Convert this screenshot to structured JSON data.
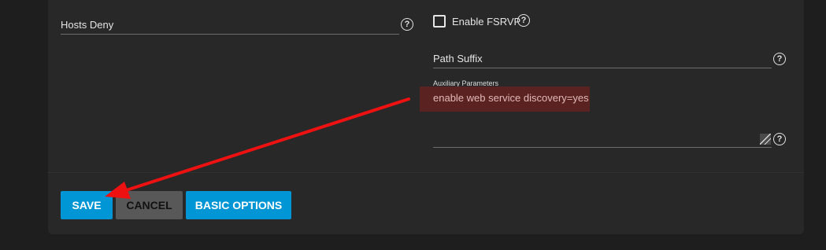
{
  "form": {
    "hosts_deny": {
      "label": "Hosts Deny",
      "help_icon": "help-circle-icon"
    },
    "enable_fsrvp": {
      "label": "Enable FSRVP",
      "checked": false,
      "help_icon": "help-circle-icon"
    },
    "path_suffix": {
      "label": "Path Suffix",
      "help_icon": "help-circle-icon"
    },
    "auxiliary_parameters": {
      "label": "Auxiliary Parameters",
      "value": "enable web service discovery=yes",
      "help_icon": "help-circle-icon",
      "resize_icon": "resize-handle-icon"
    }
  },
  "actions": {
    "save_label": "SAVE",
    "cancel_label": "CANCEL",
    "basic_options_label": "BASIC OPTIONS"
  },
  "annotation": {
    "arrow_icon": "red-arrow-icon",
    "color": "#ee1111"
  },
  "colors": {
    "background": "#1e1e1e",
    "card": "#282828",
    "primary_button": "#0095d5",
    "secondary_button": "#585858",
    "highlight": "#5b2222"
  }
}
